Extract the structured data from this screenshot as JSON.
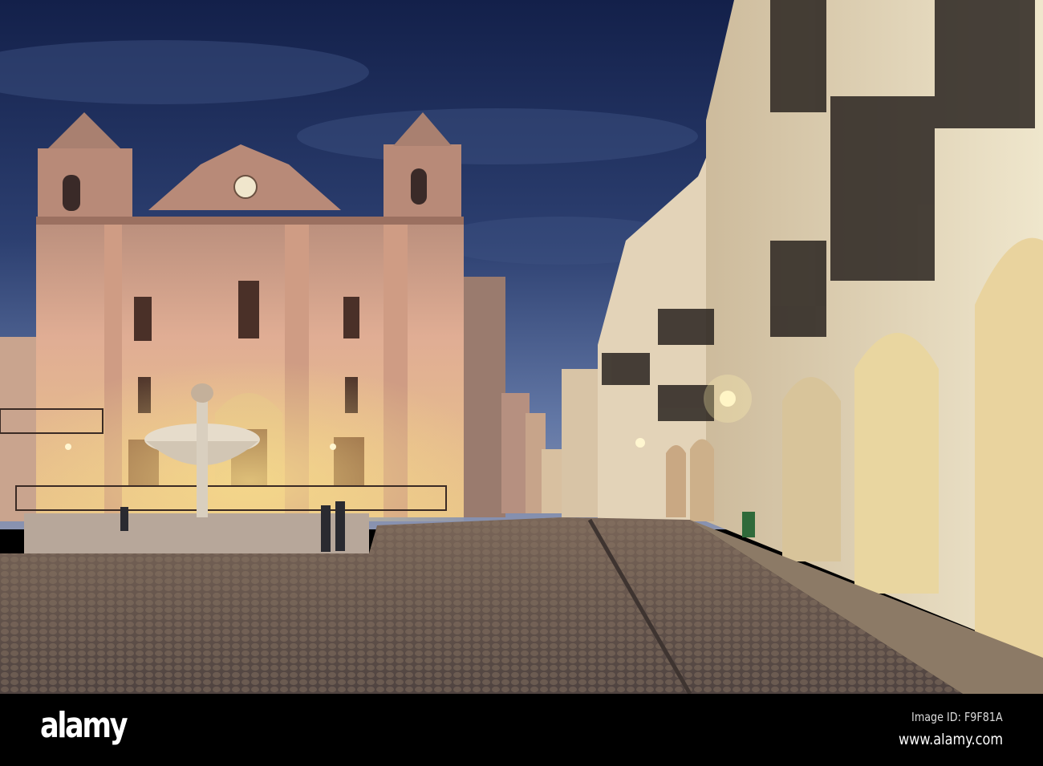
{
  "photo": {
    "subject": "Giraldo Square with Church of Santo Antao at dusk",
    "colors": {
      "sky_top": "#14204a",
      "sky_low": "#5c6f9c",
      "facade": "#d8a68a",
      "glow": "#f2cf7e",
      "arcade": "#ece2c4",
      "cobble": "#6b5b50"
    }
  },
  "footer": {
    "logo": "alamy",
    "image_id": "Image ID: F9F81A",
    "url": "www.alamy.com"
  }
}
